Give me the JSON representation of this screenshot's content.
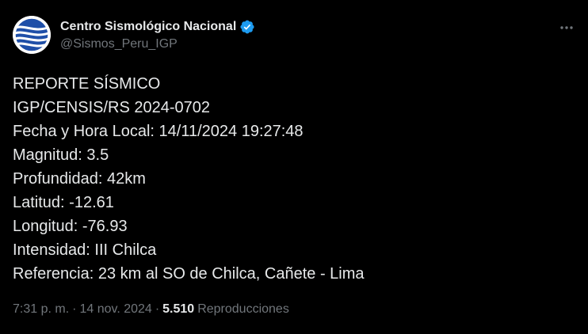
{
  "author": {
    "display_name": "Centro Sismológico Nacional",
    "handle": "@Sismos_Peru_IGP",
    "verified": true,
    "avatar_icon": "igp-logo-icon"
  },
  "more_icon": "more-options-icon",
  "tweet_lines": [
    "REPORTE SÍSMICO",
    "IGP/CENSIS/RS 2024-0702",
    "Fecha y Hora Local: 14/11/2024 19:27:48",
    "Magnitud: 3.5",
    "Profundidad: 42km",
    "Latitud: -12.61",
    "Longitud: -76.93",
    "Intensidad: III Chilca",
    "Referencia: 23 km al SO de Chilca, Cañete - Lima"
  ],
  "meta": {
    "time": "7:31 p. m.",
    "separator1": "·",
    "date": "14 nov. 2024",
    "separator2": "·",
    "views_count": "5.510",
    "views_label": "Reproducciones"
  },
  "colors": {
    "background": "#000000",
    "text_primary": "#e7e9ea",
    "text_secondary": "#71767b",
    "verified_badge": "#1d9bf0",
    "avatar_blue": "#1f4fa8"
  }
}
